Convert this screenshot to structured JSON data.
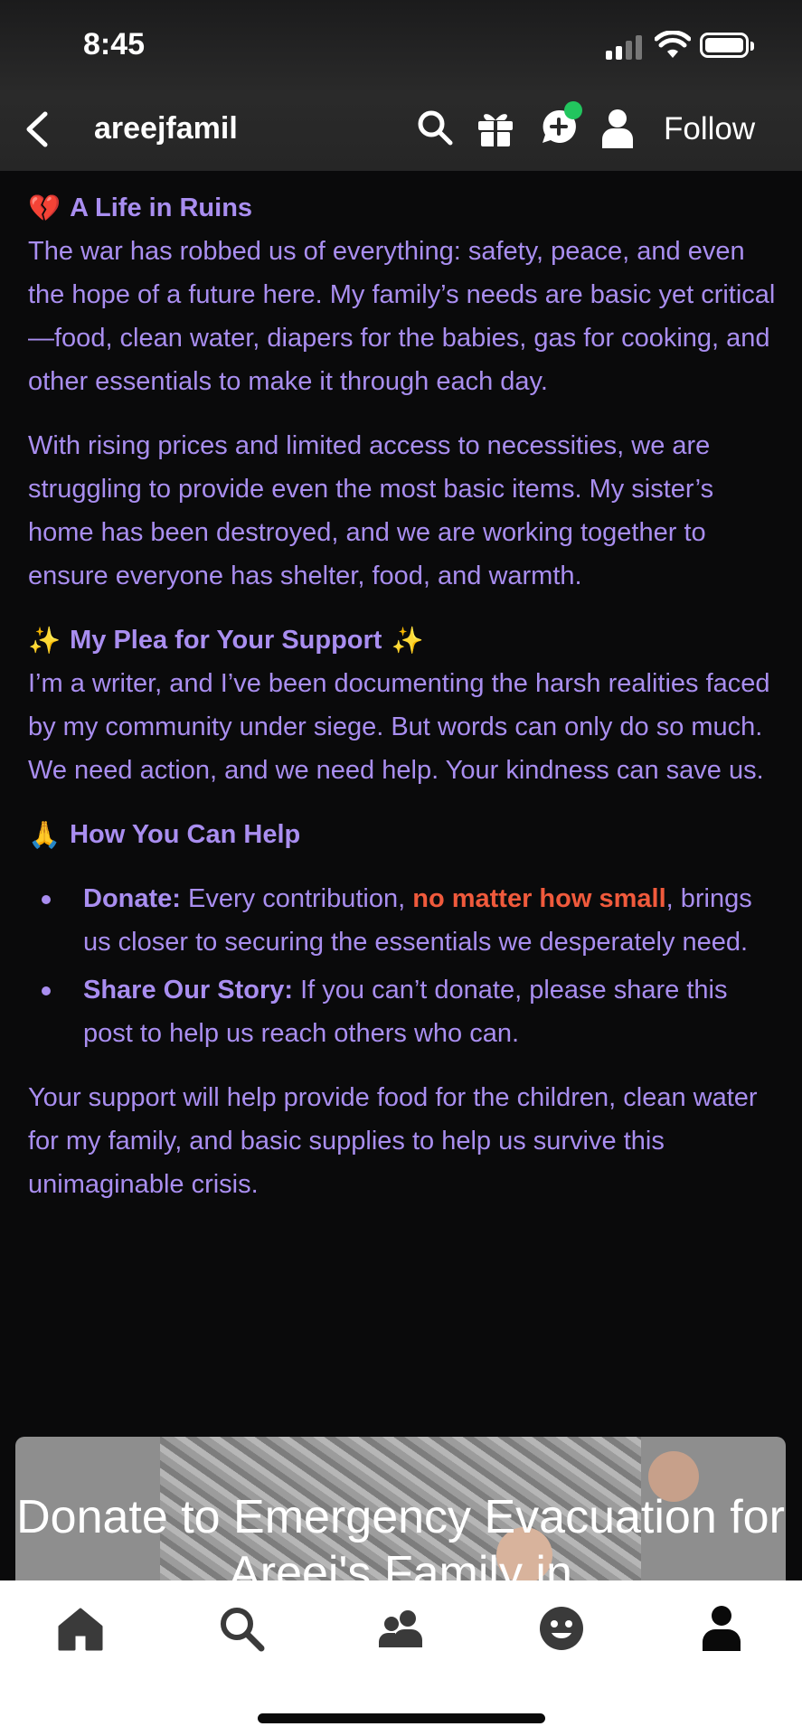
{
  "status_bar": {
    "time": "8:45"
  },
  "header": {
    "blog_name": "areejfamil",
    "follow_label": "Follow"
  },
  "post": {
    "section1_emoji": "💔",
    "section1_title": "A Life in Ruins",
    "p1": "The war has robbed us of everything: safety, peace, and even the hope of a future here. My family’s needs are basic yet critical—food, clean water, diapers for the babies, gas for cooking, and other essentials to make it through each day.",
    "p2": "With rising prices and limited access to necessities, we are struggling to provide even the most basic items. My sister’s home has been destroyed, and we are working together to ensure everyone has shelter, food, and warmth.",
    "section2_emoji": "✨",
    "section2_title": "My Plea for Your Support",
    "p3": "I’m a writer, and I’ve been documenting the harsh realities faced by my community under siege. But words can only do so much. We need action, and we need help. Your kindness can save us.",
    "section3_emoji": "🙏",
    "section3_title": "How You Can Help",
    "bullet1_label": "Donate:",
    "bullet1_text_a": " Every contribution, ",
    "bullet1_highlight": "no matter how small",
    "bullet1_text_b": ", brings us closer to securing the essentials we desperately need.",
    "bullet2_label": "Share Our Story:",
    "bullet2_text": " If you can’t donate, please share this post to help us reach others who can.",
    "p4": "Your support will help provide food for the children, clean water for my family, and basic supplies to help us survive this unimaginable crisis."
  },
  "card": {
    "title": "Donate to Emergency Evacuation for Areej's Family in"
  },
  "icons": {
    "header": [
      "back-icon",
      "search-icon",
      "gift-icon",
      "chat-icon",
      "person-icon"
    ],
    "tabs": [
      "home-icon",
      "search-icon",
      "community-icon",
      "emoji-icon",
      "account-icon"
    ]
  },
  "colors": {
    "text": "#a98ef0",
    "highlight": "#f05a3c",
    "background": "#0a0a0b",
    "badge": "#22c55e"
  }
}
